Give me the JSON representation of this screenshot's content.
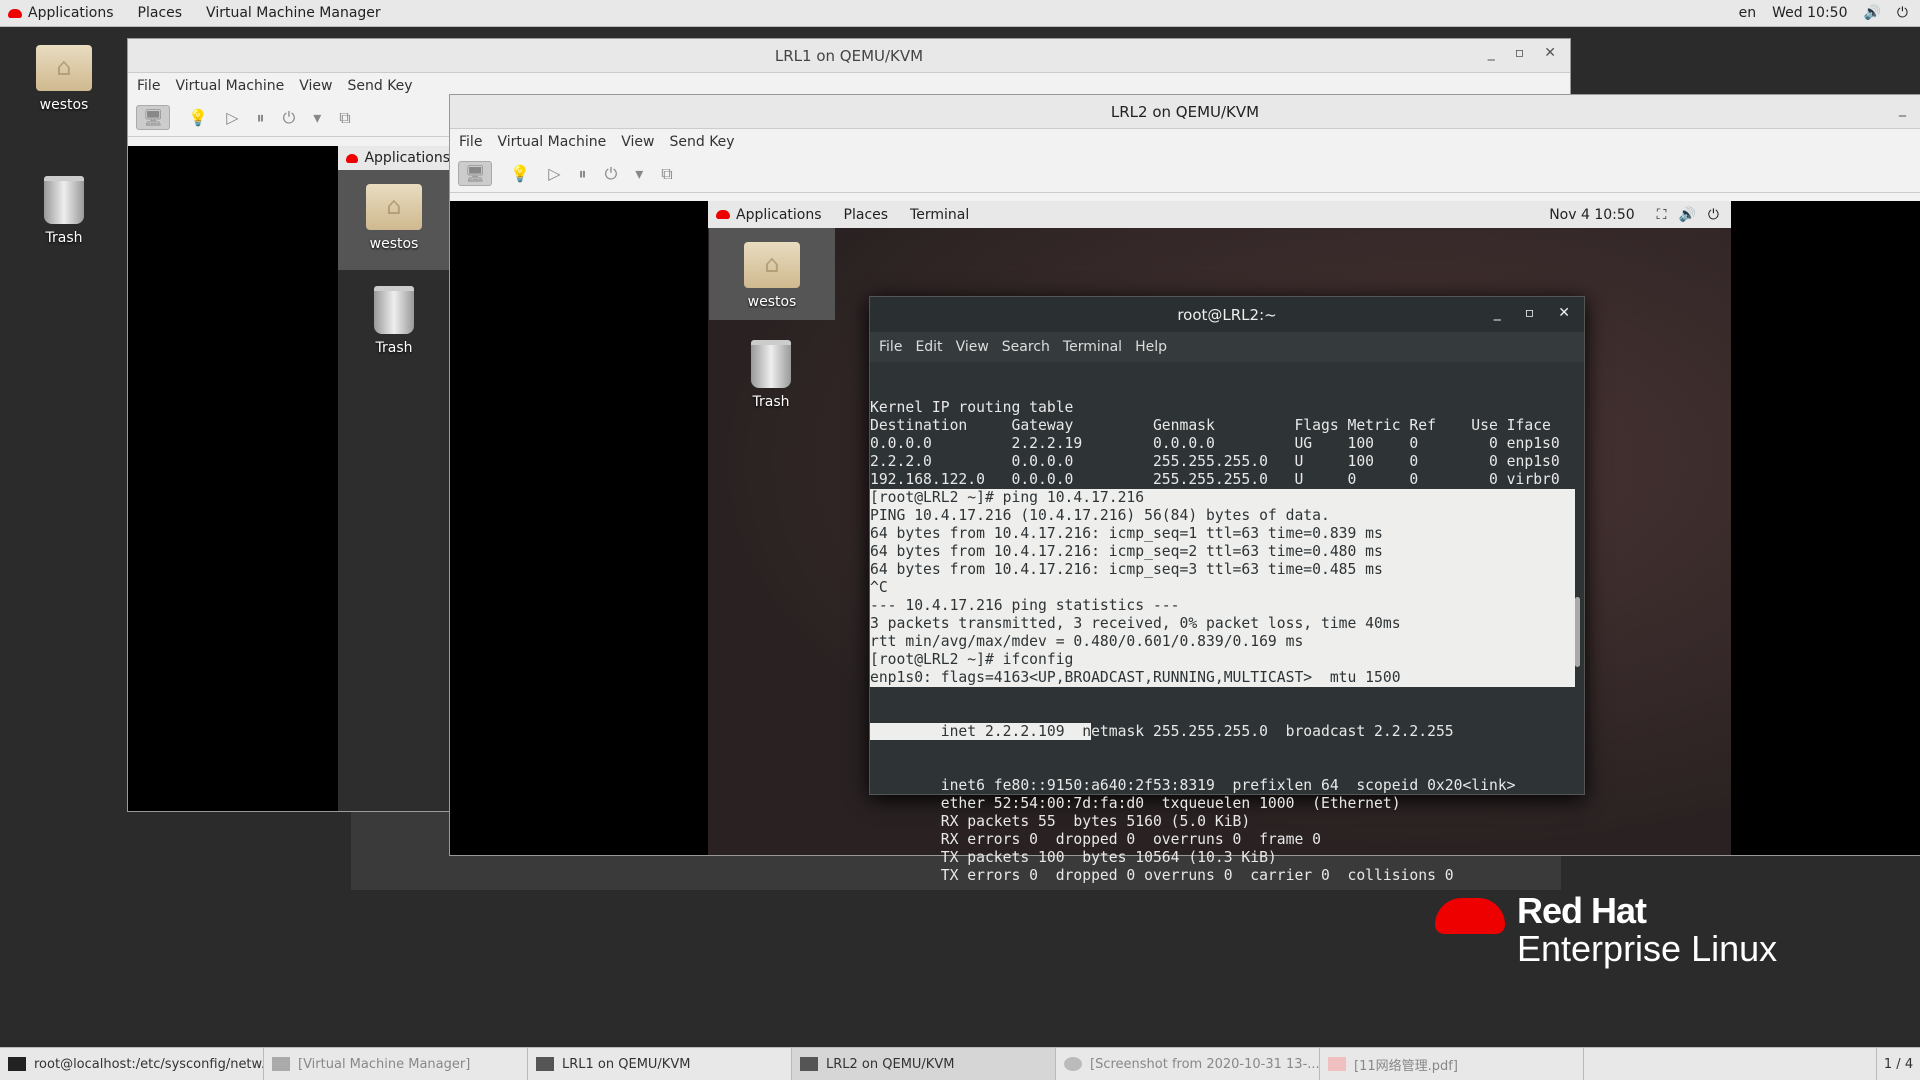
{
  "topbar": {
    "applications": "Applications",
    "places": "Places",
    "vmm": "Virtual Machine Manager",
    "lang": "en",
    "clock": "Wed 10:50"
  },
  "desktop": {
    "icons": [
      {
        "label": "westos",
        "icon": "home-folder-icon"
      },
      {
        "label": "Trash",
        "icon": "trash-icon"
      }
    ]
  },
  "lrl1": {
    "title": "LRL1 on QEMU/KVM",
    "menu": [
      "File",
      "Virtual Machine",
      "View",
      "Send Key"
    ],
    "guest_apps": "Applications",
    "icons": [
      "westos",
      "Trash"
    ]
  },
  "lrl2": {
    "title": "LRL2 on QEMU/KVM",
    "menu": [
      "File",
      "Virtual Machine",
      "View",
      "Send Key"
    ],
    "guest": {
      "applications": "Applications",
      "places": "Places",
      "terminal": "Terminal",
      "clock": "Nov 4  10:50",
      "icons": [
        "westos",
        "Trash"
      ]
    }
  },
  "terminal": {
    "title": "root@LRL2:~",
    "menu": [
      "File",
      "Edit",
      "View",
      "Search",
      "Terminal",
      "Help"
    ],
    "lines": [
      "Kernel IP routing table",
      "Destination     Gateway         Genmask         Flags Metric Ref    Use Iface",
      "0.0.0.0         2.2.2.19        0.0.0.0         UG    100    0        0 enp1s0",
      "2.2.2.0         0.0.0.0         255.255.255.0   U     100    0        0 enp1s0",
      "192.168.122.0   0.0.0.0         255.255.255.0   U     0      0        0 virbr0",
      "[root@LRL2 ~]# ping 10.4.17.216",
      "PING 10.4.17.216 (10.4.17.216) 56(84) bytes of data.",
      "64 bytes from 10.4.17.216: icmp_seq=1 ttl=63 time=0.839 ms",
      "64 bytes from 10.4.17.216: icmp_seq=2 ttl=63 time=0.480 ms",
      "64 bytes from 10.4.17.216: icmp_seq=3 ttl=63 time=0.485 ms",
      "^C",
      "--- 10.4.17.216 ping statistics ---",
      "3 packets transmitted, 3 received, 0% packet loss, time 40ms",
      "rtt min/avg/max/mdev = 0.480/0.601/0.839/0.169 ms",
      "[root@LRL2 ~]# ifconfig",
      "enp1s0: flags=4163<UP,BROADCAST,RUNNING,MULTICAST>  mtu 1500"
    ],
    "inet_sel": "        inet 2.2.2.109  n",
    "inet_rest": "etmask 255.255.255.0  broadcast 2.2.2.255",
    "tail": [
      "        inet6 fe80::9150:a640:2f53:8319  prefixlen 64  scopeid 0x20<link>",
      "        ether 52:54:00:7d:fa:d0  txqueuelen 1000  (Ethernet)",
      "        RX packets 55  bytes 5160 (5.0 KiB)",
      "        RX errors 0  dropped 0  overruns 0  frame 0",
      "        TX packets 100  bytes 10564 (10.3 KiB)",
      "        TX errors 0  dropped 0 overruns 0  carrier 0  collisions 0"
    ]
  },
  "branding": {
    "line1": "Red Hat",
    "line2": "Enterprise Linux"
  },
  "taskbar": {
    "items": [
      "root@localhost:/etc/sysconfig/netw...",
      "[Virtual Machine Manager]",
      "LRL1 on QEMU/KVM",
      "LRL2 on QEMU/KVM",
      "[Screenshot from 2020-10-31 13-...",
      "[11网络管理.pdf]"
    ],
    "workspace": "1 / 4"
  }
}
